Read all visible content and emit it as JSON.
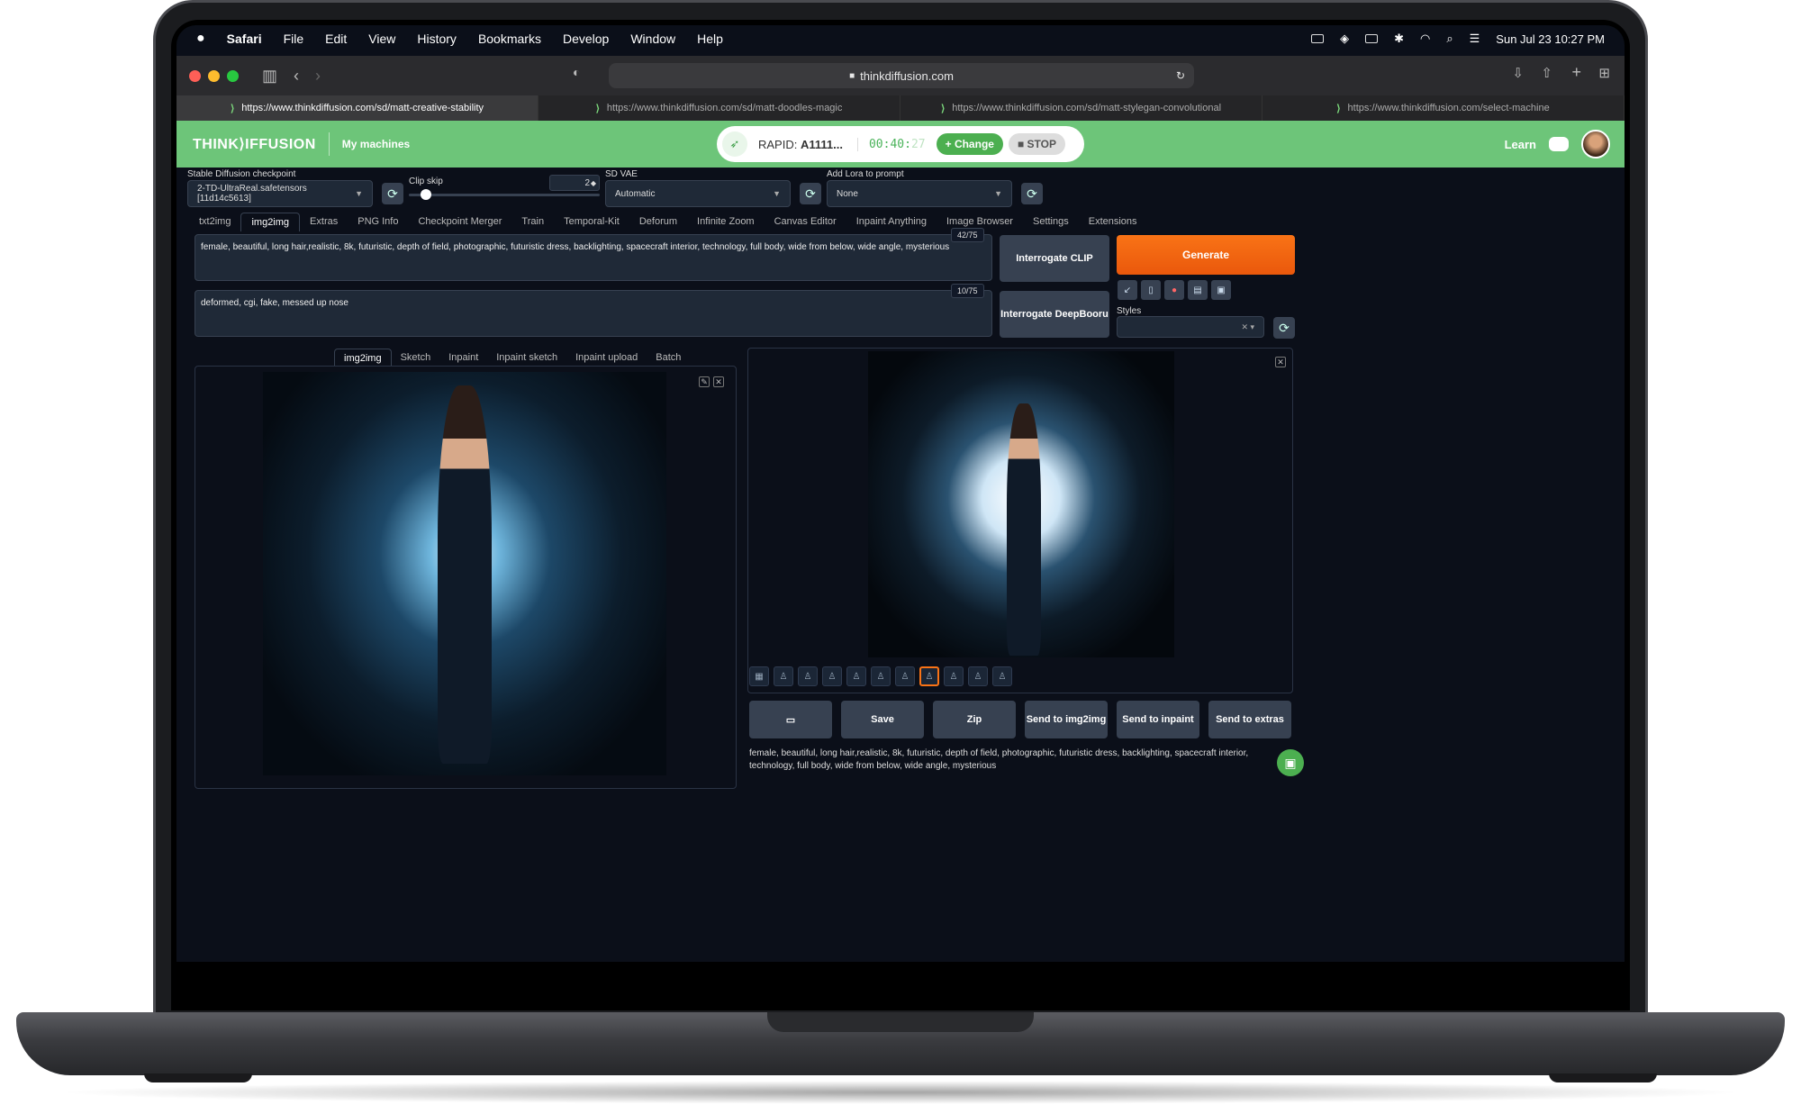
{
  "menubar": {
    "apple": "",
    "items": [
      "Safari",
      "File",
      "Edit",
      "View",
      "History",
      "Bookmarks",
      "Develop",
      "Window",
      "Help"
    ],
    "clock": "Sun Jul 23  10:27 PM"
  },
  "safari": {
    "url": "thinkdiffusion.com",
    "tabs": [
      "https://www.thinkdiffusion.com/sd/matt-creative-stability",
      "https://www.thinkdiffusion.com/sd/matt-doodles-magic",
      "https://www.thinkdiffusion.com/sd/matt-stylegan-convolutional",
      "https://www.thinkdiffusion.com/select-machine"
    ]
  },
  "header": {
    "logo": "THINK⟩IFFUSION",
    "my_machines": "My machines",
    "machine_label": "RAPID:",
    "machine_name": "A1111...",
    "timer": "00:40:",
    "timer_faded": "27",
    "change": "Change",
    "stop": "STOP",
    "learn": "Learn"
  },
  "settings": {
    "checkpoint_label": "Stable Diffusion checkpoint",
    "checkpoint_value": "2-TD-UltraReal.safetensors [11d14c5613]",
    "clip_skip_label": "Clip skip",
    "clip_skip_value": "2",
    "clip_skip_fraction": 0.09,
    "vae_label": "SD VAE",
    "vae_value": "Automatic",
    "lora_label": "Add Lora to prompt",
    "lora_value": "None"
  },
  "main_tabs": [
    "txt2img",
    "img2img",
    "Extras",
    "PNG Info",
    "Checkpoint Merger",
    "Train",
    "Temporal-Kit",
    "Deforum",
    "Infinite Zoom",
    "Canvas Editor",
    "Inpaint Anything",
    "Image Browser",
    "Settings",
    "Extensions"
  ],
  "prompt": {
    "positive": "female, beautiful, long hair,realistic, 8k, futuristic, depth of field, photographic, futuristic dress, backlighting, spacecraft interior, technology, full body, wide from below, wide angle, mysterious",
    "positive_count": "42/75",
    "negative": "deformed, cgi, fake, messed up nose",
    "negative_count": "10/75"
  },
  "buttons": {
    "interrogate_clip": "Interrogate CLIP",
    "interrogate_deepbooru": "Interrogate DeepBooru",
    "generate": "Generate",
    "styles_label": "Styles",
    "save": "Save",
    "zip": "Zip",
    "send_img2img": "Send to img2img",
    "send_inpaint": "Send to inpaint",
    "send_extras": "Send to extras"
  },
  "sub_tabs": [
    "img2img",
    "Sketch",
    "Inpaint",
    "Inpaint sketch",
    "Inpaint upload",
    "Batch"
  ],
  "caption": "female, beautiful, long hair,realistic, 8k, futuristic, depth of field, photographic, futuristic dress, backlighting, spacecraft interior, technology, full body, wide from below, wide angle, mysterious",
  "colors": {
    "accent_green": "#6dc579",
    "generate_orange": "#f97316",
    "bg": "#0b0f19"
  }
}
